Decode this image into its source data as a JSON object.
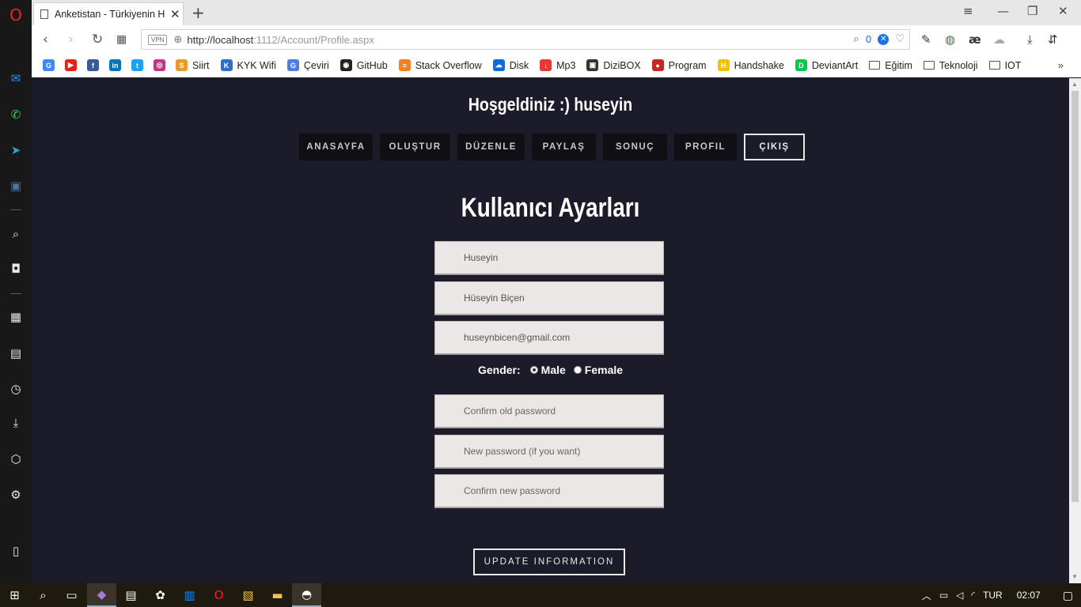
{
  "browser": {
    "tab_title": "Anketistan - Türkiyenin Hızlı",
    "url_host": "http://localhost",
    "url_rest": ":1112/Account/Profile.aspx",
    "vpn_label": "VPN",
    "ad_count": "0",
    "bookmarks": [
      {
        "label": "",
        "color": "#4285f4",
        "glyph": "G"
      },
      {
        "label": "",
        "color": "#e62117",
        "glyph": "▶"
      },
      {
        "label": "",
        "color": "#3b5998",
        "glyph": "f"
      },
      {
        "label": "",
        "color": "#0077b5",
        "glyph": "in"
      },
      {
        "label": "",
        "color": "#1da1f2",
        "glyph": "t"
      },
      {
        "label": "",
        "color": "#c13584",
        "glyph": "◎"
      },
      {
        "label": "Siirt",
        "color": "#e89a2a",
        "glyph": "S"
      },
      {
        "label": "KYK Wifi",
        "color": "#2a6fc9",
        "glyph": "K"
      },
      {
        "label": "Çeviri",
        "color": "#4a7fe0",
        "glyph": "G"
      },
      {
        "label": "GitHub",
        "color": "#222222",
        "glyph": "◉"
      },
      {
        "label": "Stack Overflow",
        "color": "#f48024",
        "glyph": "≡"
      },
      {
        "label": "Disk",
        "color": "#0a6cd6",
        "glyph": "☁"
      },
      {
        "label": "Mp3",
        "color": "#e53935",
        "glyph": "↓"
      },
      {
        "label": "DiziBOX",
        "color": "#333333",
        "glyph": "▣"
      },
      {
        "label": "Program",
        "color": "#c62828",
        "glyph": "●"
      },
      {
        "label": "Handshake",
        "color": "#f2c200",
        "glyph": "H"
      },
      {
        "label": "DeviantArt",
        "color": "#05cc47",
        "glyph": "D"
      }
    ],
    "folders": [
      "Eğitim",
      "Teknoloji",
      "IOT"
    ]
  },
  "page": {
    "welcome": "Hoşgeldiniz :) huseyin",
    "nav": [
      "ANASAYFA",
      "OLUŞTUR",
      "DÜZENLE",
      "PAYLAŞ",
      "SONUÇ",
      "PROFIL",
      "ÇIKIŞ"
    ],
    "heading": "Kullanıcı Ayarları",
    "fields": {
      "username": "Huseyin",
      "fullname": "Hüseyin Biçen",
      "email": "huseynbicen@gmail.com",
      "old_password_placeholder": "Confirm old password",
      "new_password_placeholder": "New password (if you want)",
      "confirm_password_placeholder": "Confirm new password"
    },
    "gender_label": "Gender:",
    "gender_options": [
      "Male",
      "Female"
    ],
    "gender_selected": "Male",
    "update_button": "UPDATE INFORMATION"
  },
  "taskbar": {
    "lang": "TUR",
    "time": "02:07"
  },
  "colors": {
    "page_bg": "#1c1b2a",
    "nav_bg": "#0f0f15",
    "field_bg": "#ece7e7",
    "opera_red": "#ff1b2d"
  }
}
